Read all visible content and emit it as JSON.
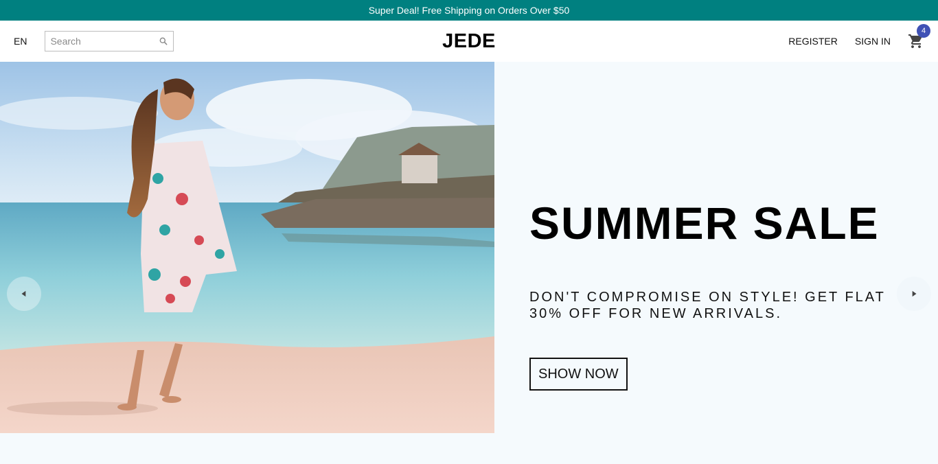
{
  "announcement": "Super Deal! Free Shipping on Orders Over $50",
  "navbar": {
    "language": "EN",
    "search_placeholder": "Search",
    "logo": "JEDE",
    "register": "REGISTER",
    "sign_in": "SIGN IN",
    "cart_count": "4"
  },
  "hero": {
    "title": "SUMMER SALE",
    "description": "DON'T COMPROMISE ON STYLE! GET FLAT 30% OFF FOR NEW ARRIVALS.",
    "button": "SHOW NOW"
  },
  "colors": {
    "announcement_bg": "#008080",
    "badge": "#3f51b5",
    "page_bg": "#f5fafd"
  },
  "icons": {
    "search": "search-icon",
    "cart": "shopping-cart-icon",
    "prev": "arrow-left-icon",
    "next": "arrow-right-icon"
  }
}
